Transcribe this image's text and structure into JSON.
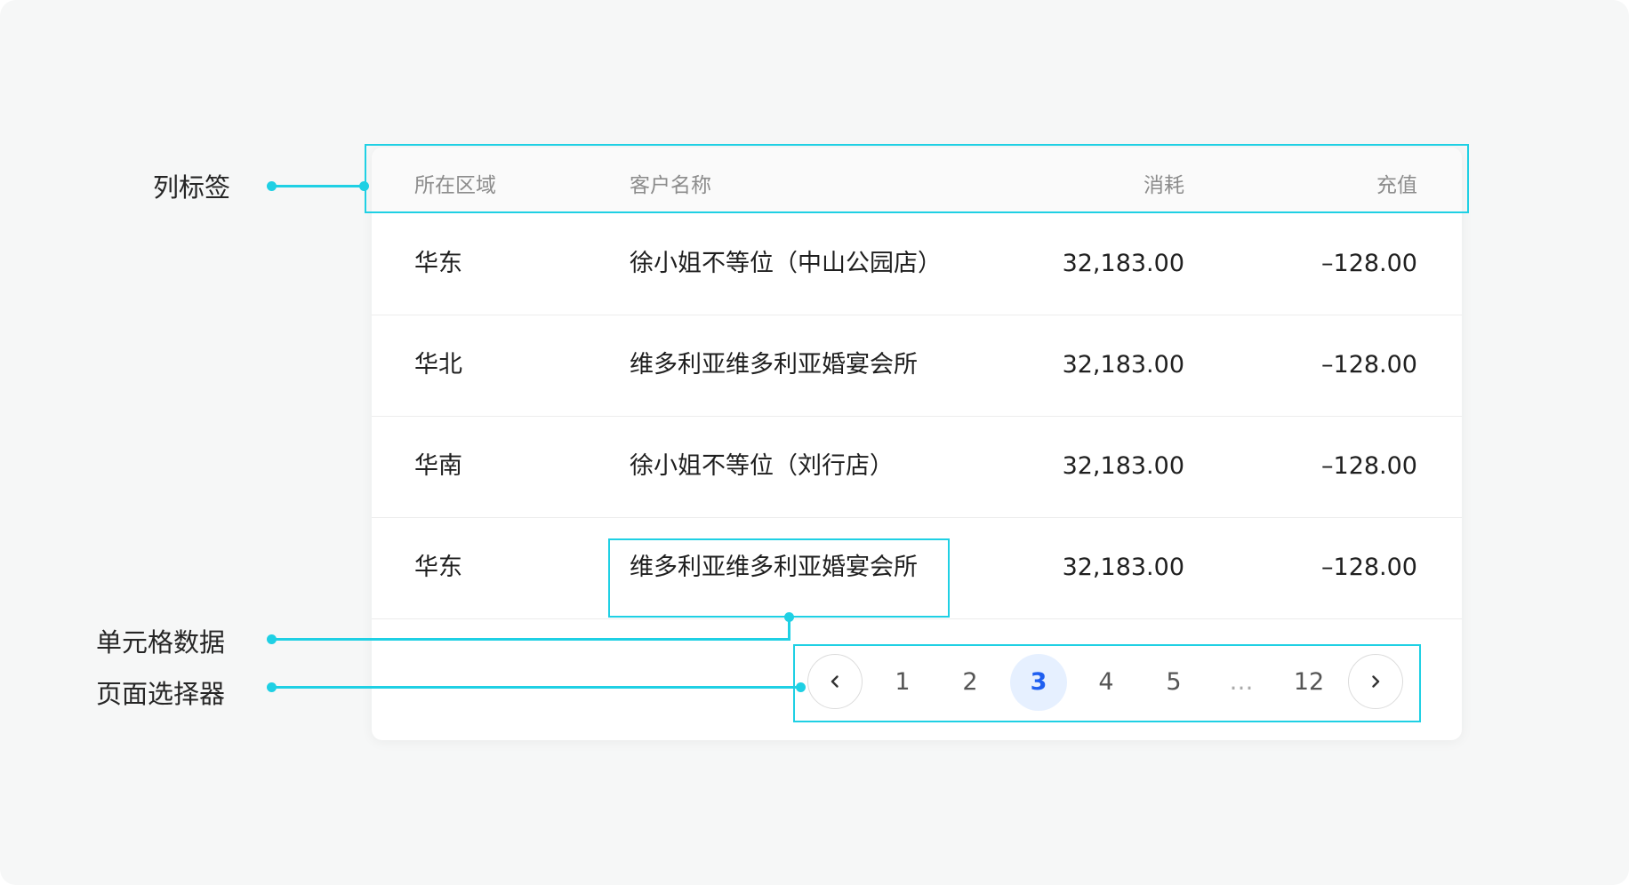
{
  "annotations": {
    "column_label": "列标签",
    "cell_data": "单元格数据",
    "page_selector": "页面选择器"
  },
  "table": {
    "headers": [
      "所在区域",
      "客户名称",
      "消耗",
      "充值"
    ],
    "rows": [
      [
        "华东",
        "徐小姐不等位（中山公园店）",
        "32,183.00",
        "–128.00"
      ],
      [
        "华北",
        "维多利亚维多利亚婚宴会所",
        "32,183.00",
        "–128.00"
      ],
      [
        "华南",
        "徐小姐不等位（刘行店）",
        "32,183.00",
        "–128.00"
      ],
      [
        "华东",
        "维多利亚维多利亚婚宴会所",
        "32,183.00",
        "–128.00"
      ]
    ]
  },
  "pagination": {
    "prev_icon": "chevron-left-icon",
    "next_icon": "chevron-right-icon",
    "pages": [
      "1",
      "2",
      "3",
      "4",
      "5",
      "…",
      "12"
    ],
    "current": "3"
  },
  "colors": {
    "annotation": "#1fd0e4",
    "active_page_bg": "#e6f0ff",
    "active_page_text": "#1f5ff0",
    "canvas_bg": "#f6f7f7"
  }
}
